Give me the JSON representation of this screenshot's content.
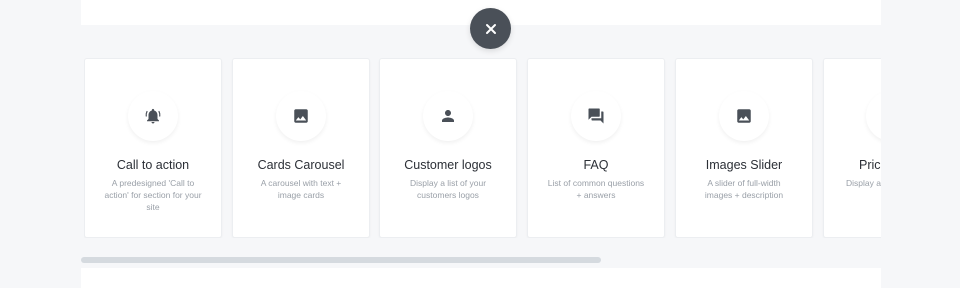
{
  "close_button": {
    "icon": "close-icon"
  },
  "cards": [
    {
      "title": "Call to action",
      "description": "A predesigned 'Call to action' for section for your site",
      "icon": "bell-icon"
    },
    {
      "title": "Cards Carousel",
      "description": "A carousel with text + image cards",
      "icon": "image-icon"
    },
    {
      "title": "Customer logos",
      "description": "Display a list of your customers logos",
      "icon": "person-icon"
    },
    {
      "title": "FAQ",
      "description": "List of common questions + answers",
      "icon": "chat-icon"
    },
    {
      "title": "Images Slider",
      "description": "A slider of full-width images + description",
      "icon": "image-icon"
    },
    {
      "title": "Pric",
      "description": "Display a",
      "icon": ""
    }
  ],
  "colors": {
    "background": "#f6f7f9",
    "card": "#ffffff",
    "icon": "#4a5058",
    "close_button": "#4a5058",
    "scrollbar": "#d5dadf"
  }
}
